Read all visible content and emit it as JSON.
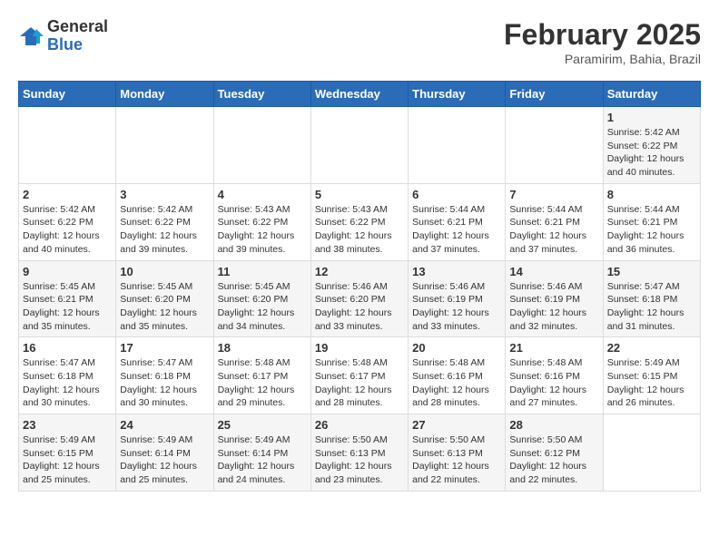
{
  "header": {
    "logo_general": "General",
    "logo_blue": "Blue",
    "month_year": "February 2025",
    "location": "Paramirim, Bahia, Brazil"
  },
  "days_of_week": [
    "Sunday",
    "Monday",
    "Tuesday",
    "Wednesday",
    "Thursday",
    "Friday",
    "Saturday"
  ],
  "weeks": [
    [
      {
        "day": "",
        "info": ""
      },
      {
        "day": "",
        "info": ""
      },
      {
        "day": "",
        "info": ""
      },
      {
        "day": "",
        "info": ""
      },
      {
        "day": "",
        "info": ""
      },
      {
        "day": "",
        "info": ""
      },
      {
        "day": "1",
        "info": "Sunrise: 5:42 AM\nSunset: 6:22 PM\nDaylight: 12 hours\nand 40 minutes."
      }
    ],
    [
      {
        "day": "2",
        "info": "Sunrise: 5:42 AM\nSunset: 6:22 PM\nDaylight: 12 hours\nand 40 minutes."
      },
      {
        "day": "3",
        "info": "Sunrise: 5:42 AM\nSunset: 6:22 PM\nDaylight: 12 hours\nand 39 minutes."
      },
      {
        "day": "4",
        "info": "Sunrise: 5:43 AM\nSunset: 6:22 PM\nDaylight: 12 hours\nand 39 minutes."
      },
      {
        "day": "5",
        "info": "Sunrise: 5:43 AM\nSunset: 6:22 PM\nDaylight: 12 hours\nand 38 minutes."
      },
      {
        "day": "6",
        "info": "Sunrise: 5:44 AM\nSunset: 6:21 PM\nDaylight: 12 hours\nand 37 minutes."
      },
      {
        "day": "7",
        "info": "Sunrise: 5:44 AM\nSunset: 6:21 PM\nDaylight: 12 hours\nand 37 minutes."
      },
      {
        "day": "8",
        "info": "Sunrise: 5:44 AM\nSunset: 6:21 PM\nDaylight: 12 hours\nand 36 minutes."
      }
    ],
    [
      {
        "day": "9",
        "info": "Sunrise: 5:45 AM\nSunset: 6:21 PM\nDaylight: 12 hours\nand 35 minutes."
      },
      {
        "day": "10",
        "info": "Sunrise: 5:45 AM\nSunset: 6:20 PM\nDaylight: 12 hours\nand 35 minutes."
      },
      {
        "day": "11",
        "info": "Sunrise: 5:45 AM\nSunset: 6:20 PM\nDaylight: 12 hours\nand 34 minutes."
      },
      {
        "day": "12",
        "info": "Sunrise: 5:46 AM\nSunset: 6:20 PM\nDaylight: 12 hours\nand 33 minutes."
      },
      {
        "day": "13",
        "info": "Sunrise: 5:46 AM\nSunset: 6:19 PM\nDaylight: 12 hours\nand 33 minutes."
      },
      {
        "day": "14",
        "info": "Sunrise: 5:46 AM\nSunset: 6:19 PM\nDaylight: 12 hours\nand 32 minutes."
      },
      {
        "day": "15",
        "info": "Sunrise: 5:47 AM\nSunset: 6:18 PM\nDaylight: 12 hours\nand 31 minutes."
      }
    ],
    [
      {
        "day": "16",
        "info": "Sunrise: 5:47 AM\nSunset: 6:18 PM\nDaylight: 12 hours\nand 30 minutes."
      },
      {
        "day": "17",
        "info": "Sunrise: 5:47 AM\nSunset: 6:18 PM\nDaylight: 12 hours\nand 30 minutes."
      },
      {
        "day": "18",
        "info": "Sunrise: 5:48 AM\nSunset: 6:17 PM\nDaylight: 12 hours\nand 29 minutes."
      },
      {
        "day": "19",
        "info": "Sunrise: 5:48 AM\nSunset: 6:17 PM\nDaylight: 12 hours\nand 28 minutes."
      },
      {
        "day": "20",
        "info": "Sunrise: 5:48 AM\nSunset: 6:16 PM\nDaylight: 12 hours\nand 28 minutes."
      },
      {
        "day": "21",
        "info": "Sunrise: 5:48 AM\nSunset: 6:16 PM\nDaylight: 12 hours\nand 27 minutes."
      },
      {
        "day": "22",
        "info": "Sunrise: 5:49 AM\nSunset: 6:15 PM\nDaylight: 12 hours\nand 26 minutes."
      }
    ],
    [
      {
        "day": "23",
        "info": "Sunrise: 5:49 AM\nSunset: 6:15 PM\nDaylight: 12 hours\nand 25 minutes."
      },
      {
        "day": "24",
        "info": "Sunrise: 5:49 AM\nSunset: 6:14 PM\nDaylight: 12 hours\nand 25 minutes."
      },
      {
        "day": "25",
        "info": "Sunrise: 5:49 AM\nSunset: 6:14 PM\nDaylight: 12 hours\nand 24 minutes."
      },
      {
        "day": "26",
        "info": "Sunrise: 5:50 AM\nSunset: 6:13 PM\nDaylight: 12 hours\nand 23 minutes."
      },
      {
        "day": "27",
        "info": "Sunrise: 5:50 AM\nSunset: 6:13 PM\nDaylight: 12 hours\nand 22 minutes."
      },
      {
        "day": "28",
        "info": "Sunrise: 5:50 AM\nSunset: 6:12 PM\nDaylight: 12 hours\nand 22 minutes."
      },
      {
        "day": "",
        "info": ""
      }
    ]
  ]
}
